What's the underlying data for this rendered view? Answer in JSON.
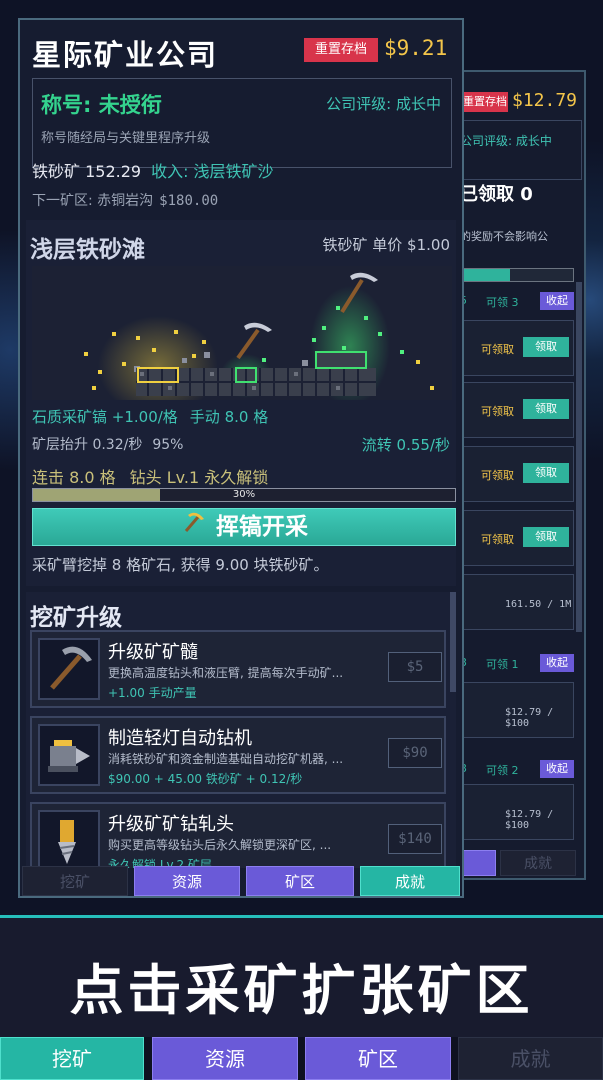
{
  "back_panel": {
    "reset_label": "重置存档",
    "money": "$12.79",
    "rating": "公司评级: 成长中",
    "claimed": "已领取 0",
    "note": "的奖励不会影响公",
    "section1": {
      "num": "5",
      "label": "可领 3",
      "collapse": "收起"
    },
    "claim_rows": [
      {
        "label": "可领取",
        "button": "领取"
      },
      {
        "label": "可领取",
        "button": "领取"
      },
      {
        "label": "可领取",
        "button": "领取"
      },
      {
        "label": "可领取",
        "button": "领取"
      }
    ],
    "progress_a": "161.50 / 1M",
    "section2": {
      "num": "3",
      "label": "可领 1",
      "collapse": "收起"
    },
    "progress_b": "$12.79 / $100",
    "section3": {
      "num": "3",
      "label": "可领 2",
      "collapse": "收起"
    },
    "progress_c": "$12.79 / $100",
    "bottom_tab": "成就"
  },
  "header": {
    "company_name": "星际矿业公司",
    "reset_label": "重置存档",
    "money": "$9.21"
  },
  "title_box": {
    "title": "称号: 未授衔",
    "rating": "公司评级: 成长中",
    "description": "称号随经局与关键里程序升级"
  },
  "resources": {
    "ore_amount": "铁砂矿 152.29",
    "income": "收入: 浅层铁矿沙",
    "next_zone": "下一矿区: 赤铜岩沟",
    "next_cost": "$180.00"
  },
  "mine": {
    "zone_name": "浅层铁砂滩",
    "price_label": "铁砂矿  单价 $1.00",
    "stat_auto": "石质采矿镐 +1.00/格",
    "stat_manual": "手动 8.0 格",
    "stat_lift": "矿层抬升 0.32/秒",
    "stat_pct": "95%",
    "flow": "流转 0.55/秒",
    "combo": "连击 8.0 格",
    "drill": "钻头 Lv.1 永久解锁",
    "progress": 0.3,
    "progress_label": "30%",
    "button_label": "挥镐开采",
    "result": "采矿臂挖掉 8 格矿石, 获得 9.00 块铁砂矿。"
  },
  "upgrades": {
    "title": "挖矿升级",
    "items": [
      {
        "name": "升级矿矿髓",
        "desc": "更换高温度钻头和液压臂, 提高每次手动矿...",
        "effect": "+1.00 手动产量",
        "cost": "$5",
        "icon": "pickaxe-icon"
      },
      {
        "name": "制造轻灯自动钻机",
        "desc": "消耗铁砂矿和资金制造基础自动挖矿机器, ...",
        "effect": "$90.00 + 45.00 铁砂矿 + 0.12/秒",
        "cost": "$90",
        "icon": "drill-machine-icon"
      },
      {
        "name": "升级矿矿钻轧头",
        "desc": "购买更高等级钻头后永久解锁更深矿区, ...",
        "effect": "永久解锁 Lv.2 矿层",
        "cost": "$140",
        "icon": "drill-bit-icon"
      }
    ]
  },
  "panel_tabs": [
    "挖矿",
    "资源",
    "矿区",
    "成就"
  ],
  "banner": "点击采矿扩张矿区",
  "bottom_tabs": [
    "挖矿",
    "资源",
    "矿区",
    "成就"
  ],
  "colors": {
    "accent": "#2fb39c",
    "gold": "#f4c64a",
    "danger": "#d8344b",
    "purple": "#6a5ad8"
  }
}
